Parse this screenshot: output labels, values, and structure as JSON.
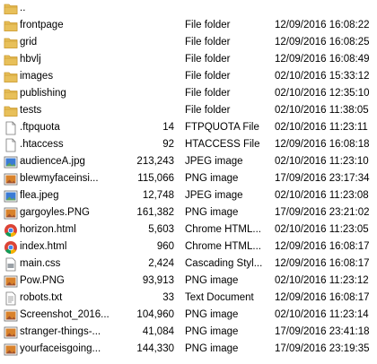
{
  "colors": {
    "folder": "#e8c05a",
    "folder_dark": "#c9962a",
    "image_blue": "#3a7bd5",
    "png_orange": "#d9822b",
    "chrome_red": "#db4437",
    "chrome_yellow": "#f4b400",
    "chrome_green": "#0f9d58",
    "chrome_blue": "#4285f4",
    "doc_gray": "#9aa0a6"
  },
  "files": [
    {
      "name": "..",
      "size": "",
      "type": "",
      "date": "",
      "icon": "folder-up-icon"
    },
    {
      "name": "frontpage",
      "size": "",
      "type": "File folder",
      "date": "12/09/2016 16:08:22",
      "icon": "folder-icon"
    },
    {
      "name": "grid",
      "size": "",
      "type": "File folder",
      "date": "12/09/2016 16:08:25",
      "icon": "folder-icon"
    },
    {
      "name": "hbvlj",
      "size": "",
      "type": "File folder",
      "date": "12/09/2016 16:08:49",
      "icon": "folder-icon"
    },
    {
      "name": "images",
      "size": "",
      "type": "File folder",
      "date": "02/10/2016 15:33:12",
      "icon": "folder-icon"
    },
    {
      "name": "publishing",
      "size": "",
      "type": "File folder",
      "date": "02/10/2016 12:35:10",
      "icon": "folder-icon"
    },
    {
      "name": "tests",
      "size": "",
      "type": "File folder",
      "date": "02/10/2016 11:38:05",
      "icon": "folder-icon"
    },
    {
      "name": ".ftpquota",
      "size": "14",
      "type": "FTPQUOTA File",
      "date": "02/10/2016 11:23:11",
      "icon": "blank-file-icon"
    },
    {
      "name": ".htaccess",
      "size": "92",
      "type": "HTACCESS File",
      "date": "12/09/2016 16:08:18",
      "icon": "blank-file-icon"
    },
    {
      "name": "audienceA.jpg",
      "size": "213,243",
      "type": "JPEG image",
      "date": "02/10/2016 11:23:10",
      "icon": "jpeg-image-icon"
    },
    {
      "name": "blewmyfaceinsi...",
      "size": "115,066",
      "type": "PNG image",
      "date": "17/09/2016 23:17:34",
      "icon": "png-image-icon"
    },
    {
      "name": "flea.jpeg",
      "size": "12,748",
      "type": "JPEG image",
      "date": "02/10/2016 11:23:08",
      "icon": "jpeg-image-icon"
    },
    {
      "name": "gargoyles.PNG",
      "size": "161,382",
      "type": "PNG image",
      "date": "17/09/2016 23:21:02",
      "icon": "png-image-icon"
    },
    {
      "name": "horizon.html",
      "size": "5,603",
      "type": "Chrome HTML...",
      "date": "02/10/2016 11:23:05",
      "icon": "chrome-icon"
    },
    {
      "name": "index.html",
      "size": "960",
      "type": "Chrome HTML...",
      "date": "12/09/2016 16:08:17",
      "icon": "chrome-icon"
    },
    {
      "name": "main.css",
      "size": "2,424",
      "type": "Cascading Styl...",
      "date": "12/09/2016 16:08:17",
      "icon": "css-file-icon"
    },
    {
      "name": "Pow.PNG",
      "size": "93,913",
      "type": "PNG image",
      "date": "02/10/2016 11:23:12",
      "icon": "png-image-icon"
    },
    {
      "name": "robots.txt",
      "size": "33",
      "type": "Text Document",
      "date": "12/09/2016 16:08:17",
      "icon": "text-file-icon"
    },
    {
      "name": "Screenshot_2016...",
      "size": "104,960",
      "type": "PNG image",
      "date": "02/10/2016 11:23:14",
      "icon": "png-image-icon"
    },
    {
      "name": "stranger-things-...",
      "size": "41,084",
      "type": "PNG image",
      "date": "17/09/2016 23:41:18",
      "icon": "png-image-icon"
    },
    {
      "name": "yourfaceisgoing...",
      "size": "144,330",
      "type": "PNG image",
      "date": "17/09/2016 23:19:35",
      "icon": "png-image-icon"
    }
  ]
}
